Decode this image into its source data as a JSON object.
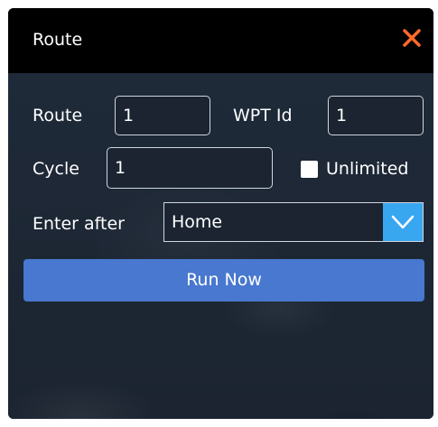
{
  "dialog": {
    "title": "Route",
    "close_icon": "close-icon",
    "close_color": "#ff6a2a"
  },
  "route_row": {
    "route_label": "Route",
    "route_value": "1",
    "wpt_label": "WPT Id",
    "wpt_value": "1"
  },
  "cycle_row": {
    "cycle_label": "Cycle",
    "cycle_value": "1",
    "unlimited_label": "Unlimited",
    "unlimited_checked": false
  },
  "enter_row": {
    "enter_label": "Enter after",
    "selected_value": "Home",
    "dropdown_icon": "chevron-down-icon"
  },
  "actions": {
    "run_label": "Run Now"
  },
  "colors": {
    "titlebar": "#000000",
    "panel": "#1e2633",
    "accent": "#39a6f0",
    "button": "#4878cf"
  }
}
